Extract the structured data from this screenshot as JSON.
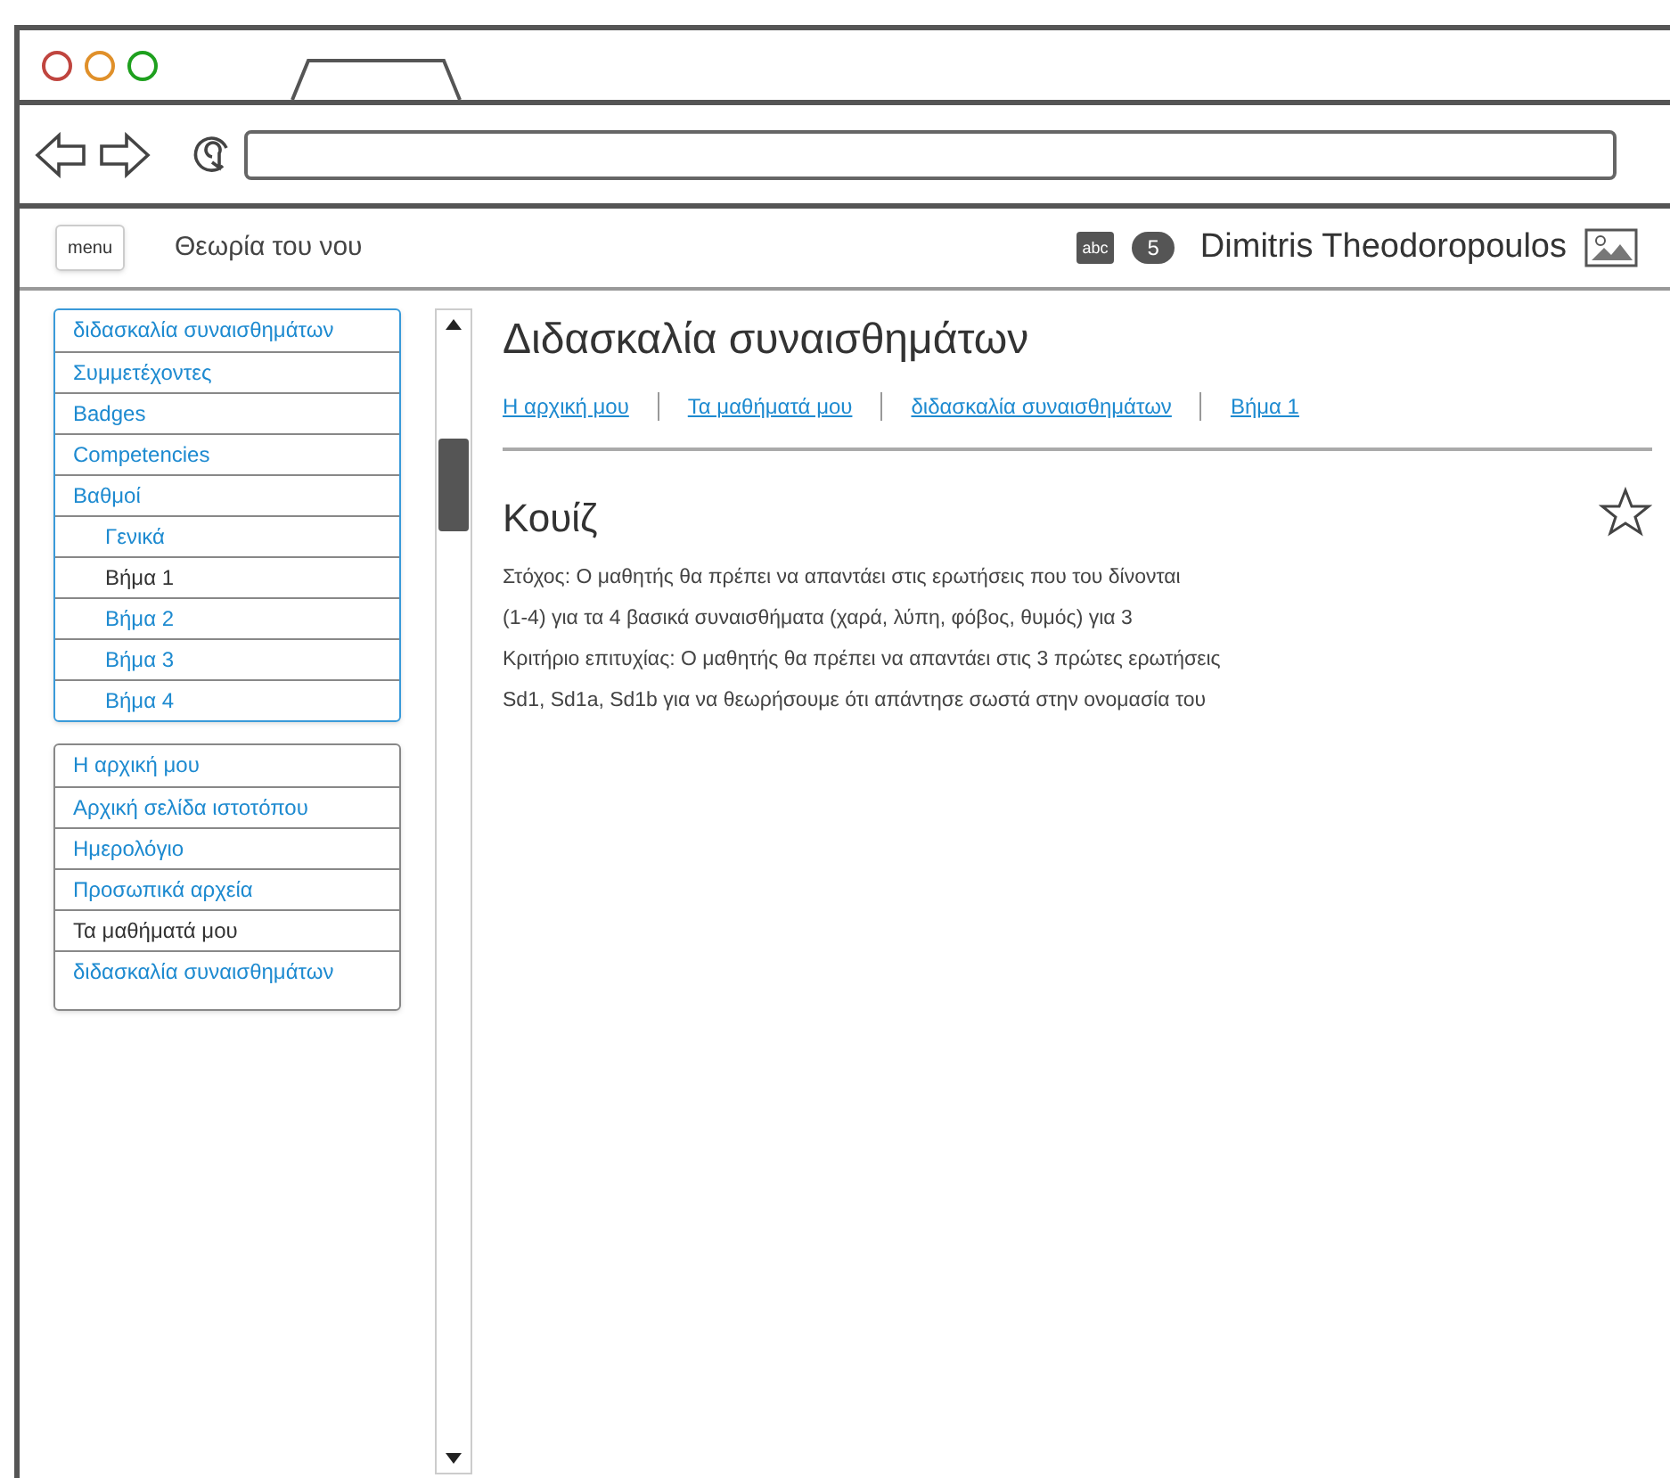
{
  "header": {
    "menu_button": "menu",
    "site_title": "Θεωρία του νου",
    "label_icon_text": "abc",
    "badge": "5",
    "user_name": "Dimitris Theodoropoulos"
  },
  "nav_block": {
    "items": [
      {
        "label": "διδασκαλία συναισθημάτων",
        "current": false
      },
      {
        "label": "Συμμετέχοντες",
        "current": false
      },
      {
        "label": "Badges",
        "current": false
      },
      {
        "label": "Competencies",
        "current": false
      },
      {
        "label": "Βαθμοί",
        "current": false,
        "children": [
          {
            "label": "Γενικά",
            "current": false
          },
          {
            "label": "Βήμα 1",
            "current": true
          },
          {
            "label": "Βήμα 2",
            "current": false
          },
          {
            "label": "Βήμα 3",
            "current": false
          },
          {
            "label": "Βήμα 4",
            "current": false
          }
        ]
      }
    ]
  },
  "navigation_block": {
    "items": [
      {
        "label": "Η αρχική μου",
        "current": false
      },
      {
        "label": "Αρχική σελίδα ιστοτόπου",
        "current": false
      },
      {
        "label": "Ημερολόγιο",
        "current": false
      },
      {
        "label": "Προσωπικά αρχεία",
        "current": false
      },
      {
        "label": "Τα μαθήματά μου",
        "current": true
      },
      {
        "label": "διδασκαλία συναισθημάτων",
        "current": false
      }
    ]
  },
  "content": {
    "title": "Διδασκαλία συναισθημάτων",
    "breadcrumb": [
      "Η αρχική μου",
      "Τα μαθήματά μου",
      "διδασκαλία συναισθημάτων",
      "Βήμα 1"
    ],
    "section_title": "Κουίζ",
    "starred": false,
    "paragraph_lines": [
      "Στόχος: Ο μαθητής θα πρέπει να απαντάει στις ερωτήσεις που του δίνονται",
      "(1-4) για τα 4 βασικά συναισθήματα (χαρά, λύπη, φόβος, θυμός) για 3",
      "Κριτήριο επιτυχίας: Ο μαθητής θα πρέπει να απαντάει στις  3 πρώτες ερωτήσεις",
      "Sd1, Sd1a, Sd1b για να θεωρήσουμε ότι απάντησε σωστά στην ονομασία του"
    ]
  }
}
